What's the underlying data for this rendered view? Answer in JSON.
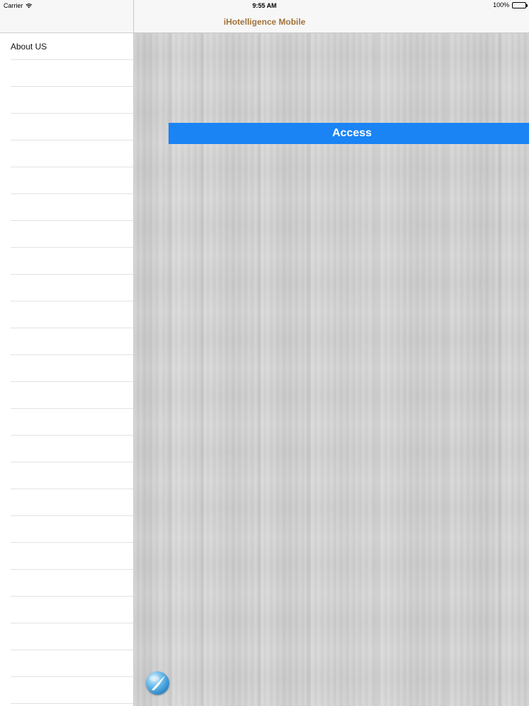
{
  "status_bar": {
    "carrier": "Carrier",
    "time": "9:55 AM",
    "battery": "100%"
  },
  "sidebar": {
    "items": [
      {
        "label": "About US"
      },
      {
        "label": ""
      },
      {
        "label": ""
      },
      {
        "label": ""
      },
      {
        "label": ""
      },
      {
        "label": ""
      },
      {
        "label": ""
      },
      {
        "label": ""
      },
      {
        "label": ""
      },
      {
        "label": ""
      },
      {
        "label": ""
      },
      {
        "label": ""
      },
      {
        "label": ""
      },
      {
        "label": ""
      },
      {
        "label": ""
      },
      {
        "label": ""
      },
      {
        "label": ""
      },
      {
        "label": ""
      },
      {
        "label": ""
      },
      {
        "label": ""
      },
      {
        "label": ""
      },
      {
        "label": ""
      },
      {
        "label": ""
      },
      {
        "label": ""
      },
      {
        "label": ""
      }
    ]
  },
  "header": {
    "title": "iHotelligence Mobile",
    "title_color": "#a0733b"
  },
  "main": {
    "access_label": "Access",
    "access_color": "#1a84f5"
  },
  "icons": {
    "wifi": "wifi-icon",
    "battery": "battery-icon",
    "logo": "logo-icon"
  }
}
